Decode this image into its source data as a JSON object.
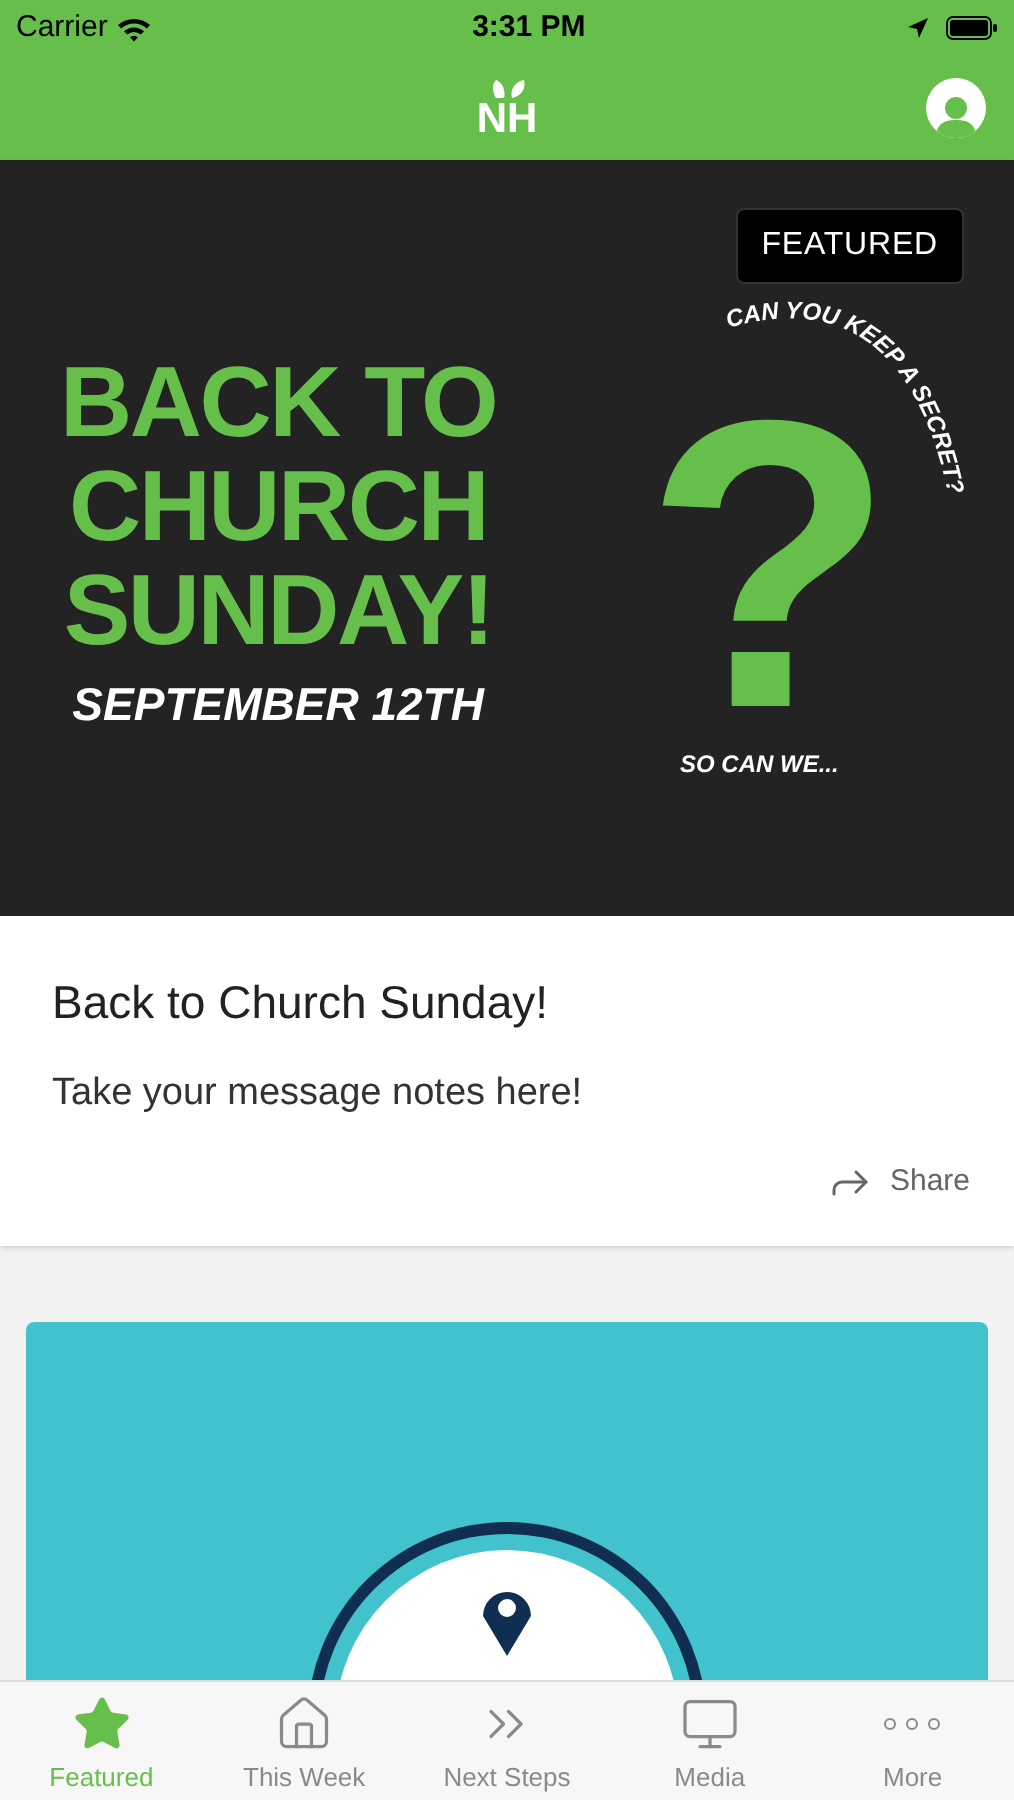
{
  "status_bar": {
    "carrier": "Carrier",
    "time": "3:31 PM"
  },
  "nav_bar": {
    "logo": "NH"
  },
  "featured": {
    "badge": "FEATURED",
    "headline": [
      "BACK TO",
      "CHURCH",
      "SUNDAY!"
    ],
    "date": "SEPTEMBER 12TH",
    "curved_text": "CAN YOU KEEP A SECRET?",
    "mark": "?",
    "tagline": "SO CAN WE...",
    "title": "Back to Church Sunday!",
    "subtitle": "Take your message notes here!",
    "share": "Share"
  },
  "tabs": [
    {
      "label": "Featured",
      "kind": "star",
      "selected": true
    },
    {
      "label": "This Week",
      "kind": "home",
      "selected": false
    },
    {
      "label": "Next Steps",
      "kind": "chevrons",
      "selected": false
    },
    {
      "label": "Media",
      "kind": "monitor",
      "selected": false
    },
    {
      "label": "More",
      "kind": "dots",
      "selected": false
    }
  ]
}
